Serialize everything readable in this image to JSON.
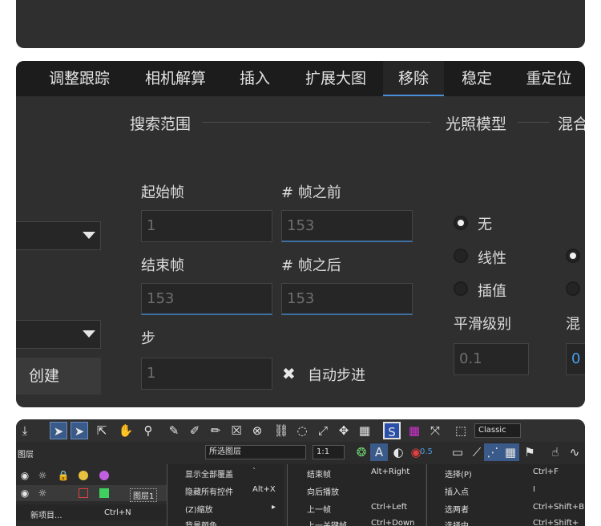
{
  "tabs": [
    {
      "label": "调整跟踪",
      "active": false
    },
    {
      "label": "相机解算",
      "active": false
    },
    {
      "label": "插入",
      "active": false
    },
    {
      "label": "扩展大图",
      "active": false
    },
    {
      "label": "移除",
      "active": true
    },
    {
      "label": "稳定",
      "active": false
    },
    {
      "label": "重定位",
      "active": false
    }
  ],
  "search_range": {
    "title": "搜索范围",
    "start_frame_label": "起始帧",
    "start_frame_value": "1",
    "frames_before_label": "# 帧之前",
    "frames_before_value": "153",
    "end_frame_label": "结束帧",
    "end_frame_value": "153",
    "frames_after_label": "# 帧之后",
    "frames_after_value": "153",
    "step_label": "步",
    "step_value": "1",
    "auto_step_label": "自动步进",
    "auto_step_checked": true
  },
  "lighting_model": {
    "title": "光照模型",
    "options": [
      {
        "label": "无",
        "checked": true
      },
      {
        "label": "线性",
        "checked": false
      },
      {
        "label": "插值",
        "checked": false
      }
    ],
    "smoothing_label": "平滑级别",
    "smoothing_value": "0.1"
  },
  "blend": {
    "title": "混合",
    "label_partial": "混",
    "value": "0"
  },
  "create_button": "创建",
  "toolbar": {
    "preset": "Classic",
    "layer_panel_label": "图层",
    "selected_layers": "所选图层",
    "zoom_ratio": "1:1",
    "value_05": "0.5",
    "layer_name": "图层1",
    "new_project": "新项目...",
    "new_project_shortcut": "Ctrl+N",
    "menu_left": [
      {
        "label": "显示全部覆盖",
        "shortcut": "`"
      },
      {
        "label": "隐藏所有控件",
        "shortcut": "Alt+X"
      },
      {
        "label": "(Z)缩放",
        "shortcut": "▸"
      },
      {
        "label": "背景颜色...",
        "shortcut": ""
      }
    ],
    "menu_mid": [
      {
        "label": "结束帧",
        "shortcut": "Alt+Right"
      },
      {
        "label": "向后播放",
        "shortcut": ""
      },
      {
        "label": "上一帧",
        "shortcut": "Ctrl+Left"
      },
      {
        "label": "上一关键帧",
        "shortcut": "Ctrl+Down"
      }
    ],
    "menu_right": [
      {
        "label": "选择(P)",
        "shortcut": "Ctrl+F"
      },
      {
        "label": "插入点",
        "shortcut": "I"
      },
      {
        "label": "选两者",
        "shortcut": "Ctrl+Shift+B"
      },
      {
        "label": "选择中",
        "shortcut": "Ctrl+Shift+"
      }
    ]
  },
  "colors": {
    "panel_bg": "#2f2f2f",
    "tabbar_bg": "#1c1c1c",
    "accent_blue": "#4a8fd9",
    "field_bg": "#262626"
  }
}
